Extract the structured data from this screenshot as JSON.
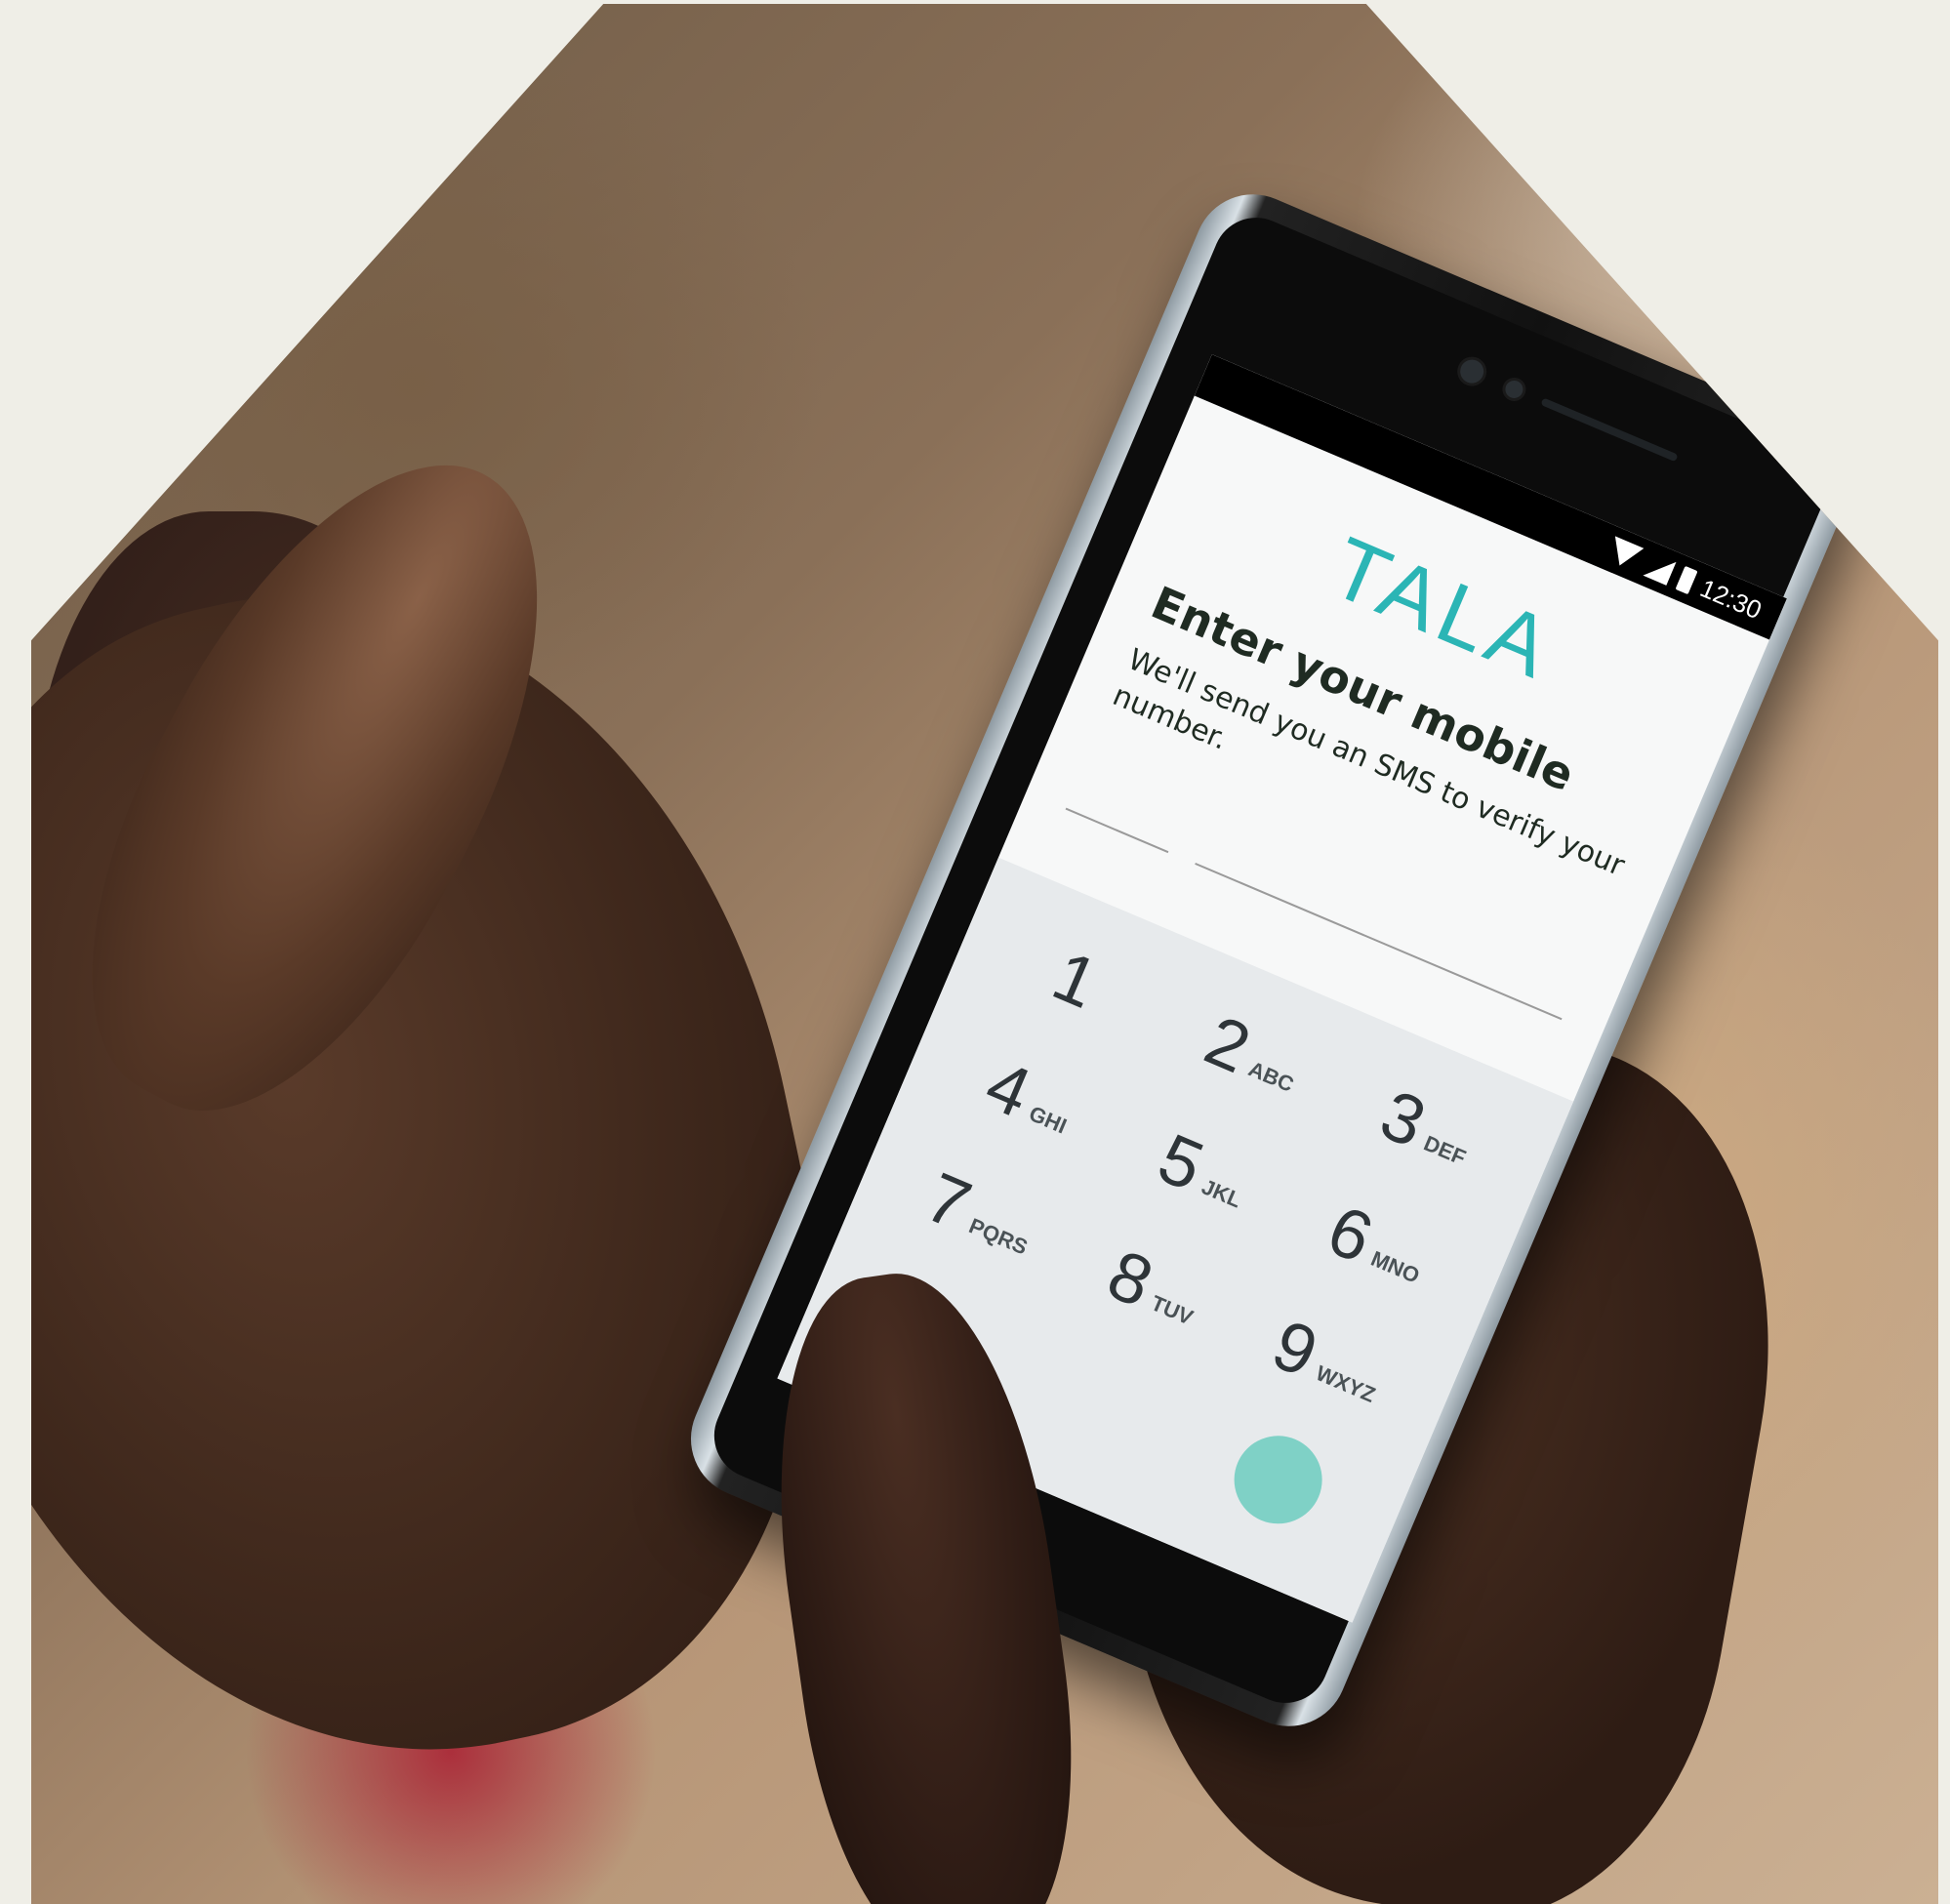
{
  "status_bar": {
    "time": "12:30"
  },
  "app": {
    "logo": "TALA"
  },
  "screen": {
    "title": "Enter your mobile",
    "subtitle": "We'll send you an SMS to verify your number."
  },
  "keypad": {
    "keys": [
      {
        "digit": "1",
        "letters": ""
      },
      {
        "digit": "2",
        "letters": "ABC"
      },
      {
        "digit": "3",
        "letters": "DEF"
      },
      {
        "digit": "4",
        "letters": "GHI"
      },
      {
        "digit": "5",
        "letters": "JKL"
      },
      {
        "digit": "6",
        "letters": "MNO"
      },
      {
        "digit": "7",
        "letters": "PQRS"
      },
      {
        "digit": "8",
        "letters": "TUV"
      },
      {
        "digit": "9",
        "letters": "WXYZ"
      }
    ],
    "backspace_symbol": "×"
  },
  "colors": {
    "brand": "#2bb5b5",
    "page_background": "#efeee7",
    "keypad_background": "#e7eaec",
    "text_dark": "#1f2b22"
  },
  "icons": [
    "wifi-icon",
    "signal-icon",
    "battery-icon",
    "backspace-icon"
  ]
}
